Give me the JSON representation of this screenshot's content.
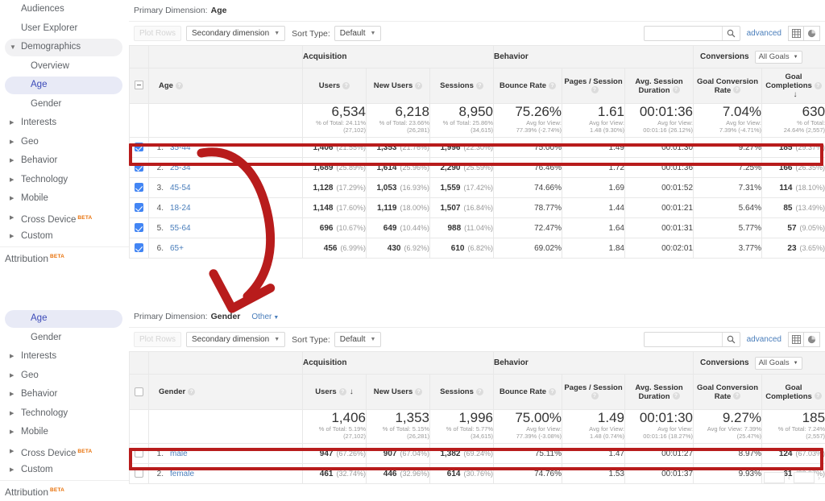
{
  "sidebar_top": {
    "items": [
      {
        "label": "Audiences",
        "caret": "",
        "indent": false,
        "state": ""
      },
      {
        "label": "User Explorer",
        "caret": "",
        "indent": false,
        "state": ""
      },
      {
        "label": "Demographics",
        "caret": "▼",
        "indent": false,
        "state": "hl"
      },
      {
        "label": "Overview",
        "caret": "",
        "indent": true,
        "state": ""
      },
      {
        "label": "Age",
        "caret": "",
        "indent": true,
        "state": "selbg"
      },
      {
        "label": "Gender",
        "caret": "",
        "indent": true,
        "state": ""
      },
      {
        "label": "Interests",
        "caret": "▶",
        "indent": false,
        "state": ""
      },
      {
        "label": "Geo",
        "caret": "▶",
        "indent": false,
        "state": ""
      },
      {
        "label": "Behavior",
        "caret": "▶",
        "indent": false,
        "state": ""
      },
      {
        "label": "Technology",
        "caret": "▶",
        "indent": false,
        "state": ""
      },
      {
        "label": "Mobile",
        "caret": "▶",
        "indent": false,
        "state": ""
      },
      {
        "label": "Cross Device",
        "caret": "▶",
        "indent": false,
        "state": "",
        "badge": "BETA"
      },
      {
        "label": "Custom",
        "caret": "▶",
        "indent": false,
        "state": ""
      }
    ],
    "attribution": {
      "label": "Attribution",
      "badge": "BETA"
    }
  },
  "sidebar_bottom": {
    "items": [
      {
        "label": "Age",
        "caret": "",
        "indent": true,
        "state": "selbg"
      },
      {
        "label": "Gender",
        "caret": "",
        "indent": true,
        "state": ""
      },
      {
        "label": "Interests",
        "caret": "▶",
        "indent": false,
        "state": ""
      },
      {
        "label": "Geo",
        "caret": "▶",
        "indent": false,
        "state": ""
      },
      {
        "label": "Behavior",
        "caret": "▶",
        "indent": false,
        "state": ""
      },
      {
        "label": "Technology",
        "caret": "▶",
        "indent": false,
        "state": ""
      },
      {
        "label": "Mobile",
        "caret": "▶",
        "indent": false,
        "state": ""
      },
      {
        "label": "Cross Device",
        "caret": "▶",
        "indent": false,
        "state": "",
        "badge": "BETA"
      },
      {
        "label": "Custom",
        "caret": "▶",
        "indent": false,
        "state": ""
      }
    ],
    "attribution": {
      "label": "Attribution",
      "badge": "BETA"
    }
  },
  "toolbar": {
    "plot_rows": "Plot Rows",
    "secondary_dimension": "Secondary dimension",
    "sort_type_label": "Sort Type:",
    "sort_type_value": "Default",
    "search_placeholder": "",
    "search_value": "",
    "advanced": "advanced",
    "caret": "▼"
  },
  "table_age": {
    "primary_dimension_label": "Primary Dimension:",
    "primary_dimension_value": "Age",
    "other_link": "",
    "groups": {
      "acquisition": "Acquisition",
      "behavior": "Behavior",
      "conversions": "Conversions",
      "goals_select": "All Goals"
    },
    "dimension_header": "Age",
    "columns": [
      "Users",
      "New Users",
      "Sessions",
      "Bounce Rate",
      "Pages / Session",
      "Avg. Session Duration",
      "Goal Conversion Rate",
      "Goal Completions"
    ],
    "sorted_column": "Goal Completions",
    "summary": [
      {
        "value": "6,534",
        "line1": "% of Total: 24.11%",
        "line2": "(27,102)"
      },
      {
        "value": "6,218",
        "line1": "% of Total: 23.66%",
        "line2": "(26,281)"
      },
      {
        "value": "8,950",
        "line1": "% of Total: 25.86%",
        "line2": "(34,615)"
      },
      {
        "value": "75.26%",
        "line1": "Avg for View:",
        "line2": "77.39% (-2.74%)"
      },
      {
        "value": "1.61",
        "line1": "Avg for View:",
        "line2": "1.48 (9.30%)"
      },
      {
        "value": "00:01:36",
        "line1": "Avg for View:",
        "line2": "00:01:16 (26.12%)"
      },
      {
        "value": "7.04%",
        "line1": "Avg for View:",
        "line2": "7.39% (-4.71%)"
      },
      {
        "value": "630",
        "line1": "% of Total:",
        "line2": "24.64% (2,557)"
      }
    ],
    "rows": [
      {
        "checked": true,
        "index": "1.",
        "name": "35-44",
        "users": "1,406",
        "users_pct": "(21.55%)",
        "new_users": "1,353",
        "new_users_pct": "(21.76%)",
        "sessions": "1,996",
        "sessions_pct": "(22.30%)",
        "bounce": "75.00%",
        "pages": "1.49",
        "duration": "00:01:30",
        "gcr": "9.27%",
        "gc": "185",
        "gc_pct": "(29.37%)"
      },
      {
        "checked": true,
        "index": "2.",
        "name": "25-34",
        "users": "1,689",
        "users_pct": "(25.89%)",
        "new_users": "1,614",
        "new_users_pct": "(25.96%)",
        "sessions": "2,290",
        "sessions_pct": "(25.59%)",
        "bounce": "76.46%",
        "pages": "1.72",
        "duration": "00:01:36",
        "gcr": "7.25%",
        "gc": "166",
        "gc_pct": "(26.35%)"
      },
      {
        "checked": true,
        "index": "3.",
        "name": "45-54",
        "users": "1,128",
        "users_pct": "(17.29%)",
        "new_users": "1,053",
        "new_users_pct": "(16.93%)",
        "sessions": "1,559",
        "sessions_pct": "(17.42%)",
        "bounce": "74.66%",
        "pages": "1.69",
        "duration": "00:01:52",
        "gcr": "7.31%",
        "gc": "114",
        "gc_pct": "(18.10%)"
      },
      {
        "checked": true,
        "index": "4.",
        "name": "18-24",
        "users": "1,148",
        "users_pct": "(17.60%)",
        "new_users": "1,119",
        "new_users_pct": "(18.00%)",
        "sessions": "1,507",
        "sessions_pct": "(16.84%)",
        "bounce": "78.77%",
        "pages": "1.44",
        "duration": "00:01:21",
        "gcr": "5.64%",
        "gc": "85",
        "gc_pct": "(13.49%)"
      },
      {
        "checked": true,
        "index": "5.",
        "name": "55-64",
        "users": "696",
        "users_pct": "(10.67%)",
        "new_users": "649",
        "new_users_pct": "(10.44%)",
        "sessions": "988",
        "sessions_pct": "(11.04%)",
        "bounce": "72.47%",
        "pages": "1.64",
        "duration": "00:01:31",
        "gcr": "5.77%",
        "gc": "57",
        "gc_pct": "(9.05%)"
      },
      {
        "checked": true,
        "index": "6.",
        "name": "65+",
        "users": "456",
        "users_pct": "(6.99%)",
        "new_users": "430",
        "new_users_pct": "(6.92%)",
        "sessions": "610",
        "sessions_pct": "(6.82%)",
        "bounce": "69.02%",
        "pages": "1.84",
        "duration": "00:02:01",
        "gcr": "3.77%",
        "gc": "23",
        "gc_pct": "(3.65%)"
      }
    ]
  },
  "table_gender": {
    "primary_dimension_label": "Primary Dimension:",
    "primary_dimension_value": "Gender",
    "other_link": "Other",
    "groups": {
      "acquisition": "Acquisition",
      "behavior": "Behavior",
      "conversions": "Conversions",
      "goals_select": "All Goals"
    },
    "dimension_header": "Gender",
    "columns": [
      "Users",
      "New Users",
      "Sessions",
      "Bounce Rate",
      "Pages / Session",
      "Avg. Session Duration",
      "Goal Conversion Rate",
      "Goal Completions"
    ],
    "sorted_column": "Users",
    "summary": [
      {
        "value": "1,406",
        "line1": "% of Total: 5.19%",
        "line2": "(27,102)"
      },
      {
        "value": "1,353",
        "line1": "% of Total: 5.15%",
        "line2": "(26,281)"
      },
      {
        "value": "1,996",
        "line1": "% of Total: 5.77%",
        "line2": "(34,615)"
      },
      {
        "value": "75.00%",
        "line1": "Avg for View:",
        "line2": "77.39% (-3.08%)"
      },
      {
        "value": "1.49",
        "line1": "Avg for View:",
        "line2": "1.48 (0.74%)"
      },
      {
        "value": "00:01:30",
        "line1": "Avg for View:",
        "line2": "00:01:16 (18.27%)"
      },
      {
        "value": "9.27%",
        "line1": "Avg for View: 7.39%",
        "line2": "(25.47%)"
      },
      {
        "value": "185",
        "line1": "% of Total: 7.24%",
        "line2": "(2,557)"
      }
    ],
    "rows": [
      {
        "checked": false,
        "index": "1.",
        "name": "male",
        "users": "947",
        "users_pct": "(67.26%)",
        "new_users": "907",
        "new_users_pct": "(67.04%)",
        "sessions": "1,382",
        "sessions_pct": "(69.24%)",
        "bounce": "75.11%",
        "pages": "1.47",
        "duration": "00:01:27",
        "gcr": "8.97%",
        "gc": "124",
        "gc_pct": "(67.03%)"
      },
      {
        "checked": false,
        "index": "2.",
        "name": "female",
        "users": "461",
        "users_pct": "(32.74%)",
        "new_users": "446",
        "new_users_pct": "(32.96%)",
        "sessions": "614",
        "sessions_pct": "(30.76%)",
        "bounce": "74.76%",
        "pages": "1.53",
        "duration": "00:01:37",
        "gcr": "9.93%",
        "gc": "61",
        "gc_pct": "(32.97%)"
      }
    ]
  },
  "annotations": {
    "accent_color": "#b81c1c",
    "highlight_age_row": "35-44",
    "highlight_gender_row": "male",
    "arrow_from": "35-44",
    "arrow_to": "Other"
  }
}
